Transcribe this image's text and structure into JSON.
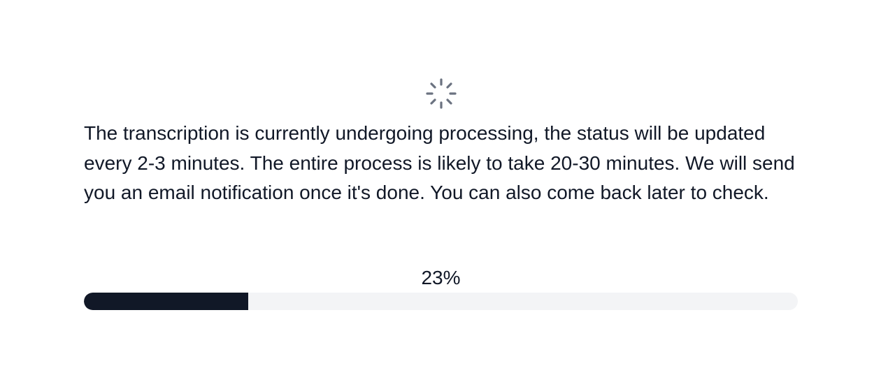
{
  "status": {
    "spinner_icon": "loading-spinner-icon",
    "message": "The transcription is currently undergoing processing, the status will be updated every 2-3 minutes. The entire process is likely to take 20-30 minutes. We will send you an email notification once it's done. You can also come back later to check.",
    "progress_label": "23%",
    "progress_value": 23,
    "colors": {
      "text": "#111827",
      "spinner": "#6b7280",
      "track": "#f3f4f6",
      "fill": "#111827"
    }
  }
}
